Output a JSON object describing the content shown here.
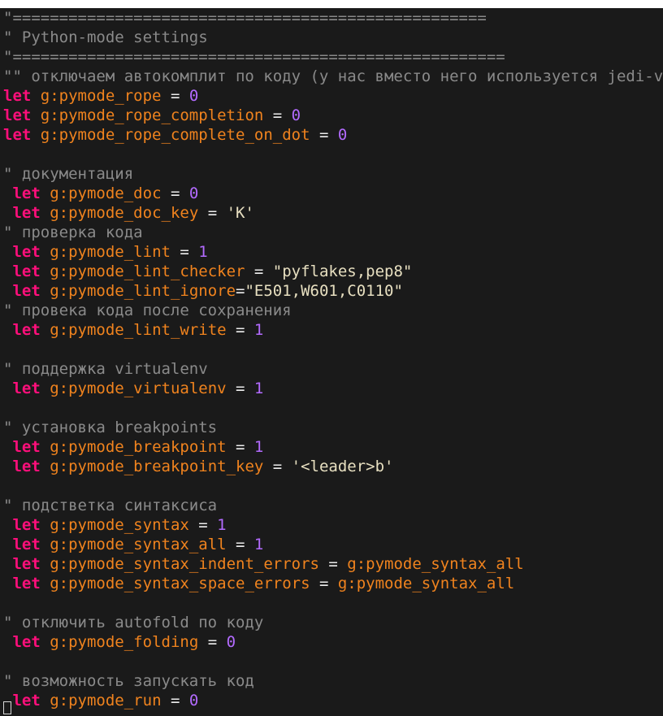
{
  "colors": {
    "background": "#1a1a1a",
    "comment": "#8a8a8a",
    "keyword": "#ff0f7b",
    "variable": "#f0831e",
    "number": "#b36bff",
    "string": "#e7dfc0"
  },
  "lines": [
    {
      "type": "comment",
      "text": "\"==================================================="
    },
    {
      "type": "comment",
      "text": "\" Python-mode settings"
    },
    {
      "type": "comment",
      "text": "\"====================================================="
    },
    {
      "type": "comment",
      "text": "\"\" отключаем автокомплит по коду (у нас вместо него используется jedi-vim)"
    },
    {
      "type": "let",
      "indent": "",
      "var": "g:pymode_rope",
      "op": " = ",
      "valtype": "num",
      "val": "0"
    },
    {
      "type": "let",
      "indent": "",
      "var": "g:pymode_rope_completion",
      "op": " = ",
      "valtype": "num",
      "val": "0"
    },
    {
      "type": "let",
      "indent": "",
      "var": "g:pymode_rope_complete_on_dot",
      "op": " = ",
      "valtype": "num",
      "val": "0"
    },
    {
      "type": "blank",
      "text": ""
    },
    {
      "type": "comment",
      "text": "\" документация"
    },
    {
      "type": "let",
      "indent": " ",
      "var": "g:pymode_doc",
      "op": " = ",
      "valtype": "num",
      "val": "0"
    },
    {
      "type": "let",
      "indent": " ",
      "var": "g:pymode_doc_key",
      "op": " = ",
      "valtype": "str",
      "val": "'K'"
    },
    {
      "type": "comment",
      "text": "\" проверка кода"
    },
    {
      "type": "let",
      "indent": " ",
      "var": "g:pymode_lint",
      "op": " = ",
      "valtype": "num",
      "val": "1"
    },
    {
      "type": "let",
      "indent": " ",
      "var": "g:pymode_lint_checker",
      "op": " = ",
      "valtype": "str",
      "val": "\"pyflakes,pep8\""
    },
    {
      "type": "let",
      "indent": " ",
      "var": "g:pymode_lint_ignore",
      "op": "=",
      "valtype": "str",
      "val": "\"E501,W601,C0110\""
    },
    {
      "type": "comment",
      "text": "\" провека кода после сохранения"
    },
    {
      "type": "let",
      "indent": " ",
      "var": "g:pymode_lint_write",
      "op": " = ",
      "valtype": "num",
      "val": "1"
    },
    {
      "type": "blank",
      "text": ""
    },
    {
      "type": "comment",
      "text": "\" поддержка virtualenv"
    },
    {
      "type": "let",
      "indent": " ",
      "var": "g:pymode_virtualenv",
      "op": " = ",
      "valtype": "num",
      "val": "1"
    },
    {
      "type": "blank",
      "text": ""
    },
    {
      "type": "comment",
      "text": "\" установка breakpoints"
    },
    {
      "type": "let",
      "indent": " ",
      "var": "g:pymode_breakpoint",
      "op": " = ",
      "valtype": "num",
      "val": "1"
    },
    {
      "type": "let",
      "indent": " ",
      "var": "g:pymode_breakpoint_key",
      "op": " = ",
      "valtype": "str",
      "val": "'<leader>b'"
    },
    {
      "type": "blank",
      "text": ""
    },
    {
      "type": "comment",
      "text": "\" подстветка синтаксиса"
    },
    {
      "type": "let",
      "indent": " ",
      "var": "g:pymode_syntax",
      "op": " = ",
      "valtype": "num",
      "val": "1"
    },
    {
      "type": "let",
      "indent": " ",
      "var": "g:pymode_syntax_all",
      "op": " = ",
      "valtype": "num",
      "val": "1"
    },
    {
      "type": "let",
      "indent": " ",
      "var": "g:pymode_syntax_indent_errors",
      "op": " = ",
      "valtype": "var",
      "val": "g:pymode_syntax_all"
    },
    {
      "type": "let",
      "indent": " ",
      "var": "g:pymode_syntax_space_errors",
      "op": " = ",
      "valtype": "var",
      "val": "g:pymode_syntax_all"
    },
    {
      "type": "blank",
      "text": ""
    },
    {
      "type": "comment",
      "text": "\" отключить autofold по коду"
    },
    {
      "type": "let",
      "indent": " ",
      "var": "g:pymode_folding",
      "op": " = ",
      "valtype": "num",
      "val": "0"
    },
    {
      "type": "blank",
      "text": ""
    },
    {
      "type": "comment",
      "text": "\" возможность запускать код"
    },
    {
      "type": "let",
      "indent": " ",
      "var": "g:pymode_run",
      "op": " = ",
      "valtype": "num",
      "val": "0"
    }
  ],
  "keyword": "let"
}
